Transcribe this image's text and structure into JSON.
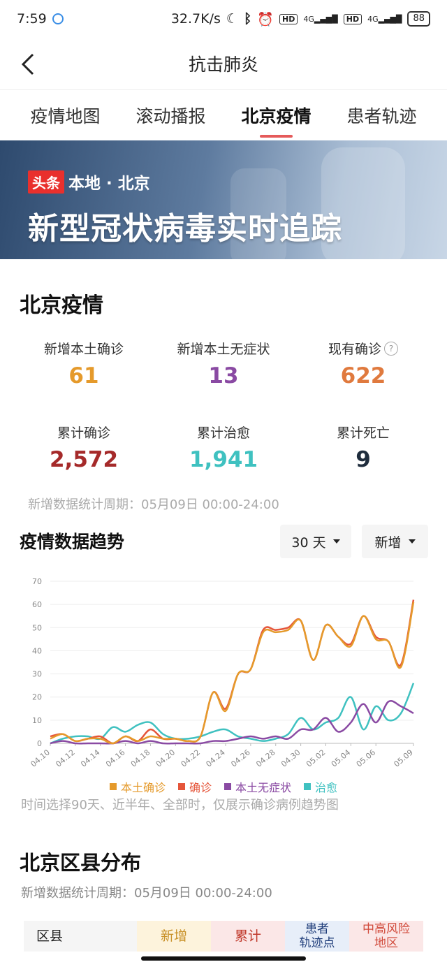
{
  "status_bar": {
    "time": "7:59",
    "speed": "32.7K/s",
    "hd": "HD",
    "net": "4G",
    "battery": "88"
  },
  "header": {
    "title": "抗击肺炎"
  },
  "tabs": [
    {
      "label": "疫情地图"
    },
    {
      "label": "滚动播报"
    },
    {
      "label": "北京疫情",
      "active": true
    },
    {
      "label": "患者轨迹"
    }
  ],
  "banner": {
    "tag": "头条",
    "location": "本地 · 北京",
    "title": "新型冠状病毒实时追踪"
  },
  "beijing": {
    "title": "北京疫情",
    "stats": [
      {
        "label": "新增本土确诊",
        "value": "61",
        "color": "#e59a2b"
      },
      {
        "label": "新增本土无症状",
        "value": "13",
        "color": "#8a4aa3"
      },
      {
        "label": "现有确诊",
        "value": "622",
        "color": "#e07a3e",
        "info": "?"
      },
      {
        "label": "累计确诊",
        "value": "2,572",
        "color": "#a52a2a"
      },
      {
        "label": "累计治愈",
        "value": "1,941",
        "color": "#3fc1c0"
      },
      {
        "label": "累计死亡",
        "value": "9",
        "color": "#1f2d3d"
      }
    ],
    "note": "新增数据统计周期：05月09日 00:00-24:00"
  },
  "trend": {
    "title": "疫情数据趋势",
    "range_select": "30 天",
    "type_select": "新增",
    "footnote": "时间选择90天、近半年、全部时，仅展示确诊病例趋势图"
  },
  "chart_data": {
    "type": "line",
    "x": [
      "04.10",
      "04.11",
      "04.12",
      "04.13",
      "04.14",
      "04.15",
      "04.16",
      "04.17",
      "04.18",
      "04.19",
      "04.20",
      "04.21",
      "04.22",
      "04.23",
      "04.24",
      "04.25",
      "04.26",
      "04.27",
      "04.28",
      "04.29",
      "04.30",
      "05.01",
      "05.02",
      "05.03",
      "05.04",
      "05.05",
      "05.06",
      "05.07",
      "05.08",
      "05.09"
    ],
    "xticks": [
      "04.10",
      "04.12",
      "04.14",
      "04.16",
      "04.18",
      "04.20",
      "04.22",
      "04.24",
      "04.26",
      "04.28",
      "04.30",
      "05.02",
      "05.04",
      "05.06",
      "05.09"
    ],
    "ylim": [
      0,
      70
    ],
    "yticks": [
      0,
      10,
      20,
      30,
      40,
      50,
      60,
      70
    ],
    "grid": true,
    "legend_position": "bottom",
    "series": [
      {
        "name": "本土确诊",
        "color": "#e59a2b",
        "values": [
          2,
          4,
          1,
          2,
          2,
          0,
          3,
          1,
          3,
          2,
          2,
          1,
          3,
          22,
          14,
          30,
          32,
          48,
          48,
          49,
          53,
          36,
          51,
          46,
          42,
          55,
          45,
          44,
          33,
          61
        ]
      },
      {
        "name": "确诊",
        "color": "#e5553a",
        "values": [
          3,
          4,
          1,
          2,
          3,
          0,
          3,
          1,
          6,
          2,
          2,
          1,
          3,
          22,
          15,
          30,
          32,
          49,
          49,
          50,
          53,
          36,
          51,
          46,
          43,
          55,
          46,
          44,
          34,
          62
        ]
      },
      {
        "name": "本土无症状",
        "color": "#8a4aa3",
        "values": [
          0,
          1,
          0,
          0,
          0,
          0,
          1,
          0,
          1,
          0,
          0,
          0,
          0,
          1,
          1,
          2,
          3,
          2,
          3,
          2,
          6,
          6,
          11,
          5,
          9,
          17,
          9,
          18,
          16,
          13
        ]
      },
      {
        "name": "治愈",
        "color": "#3fc1c0",
        "values": [
          0,
          2,
          3,
          3,
          2,
          7,
          5,
          8,
          9,
          4,
          2,
          2,
          3,
          5,
          6,
          3,
          2,
          1,
          2,
          4,
          11,
          6,
          9,
          11,
          20,
          6,
          16,
          10,
          13,
          26
        ]
      }
    ]
  },
  "district": {
    "title": "北京区县分布",
    "note": "新增数据统计周期：05月09日 00:00-24:00",
    "columns": [
      {
        "label": "区县",
        "bg": "#f5f5f5",
        "color": "#222"
      },
      {
        "label": "新增",
        "bg": "#fdf3dc",
        "color": "#c9922a"
      },
      {
        "label": "累计",
        "bg": "#fbe7e7",
        "color": "#c0392b"
      },
      {
        "label": "患者\n轨迹点",
        "bg": "#e7eef9",
        "color": "#1f3d7a"
      },
      {
        "label": "中高风险\n地区",
        "bg": "#fbe7e7",
        "color": "#d14b3c"
      }
    ]
  }
}
